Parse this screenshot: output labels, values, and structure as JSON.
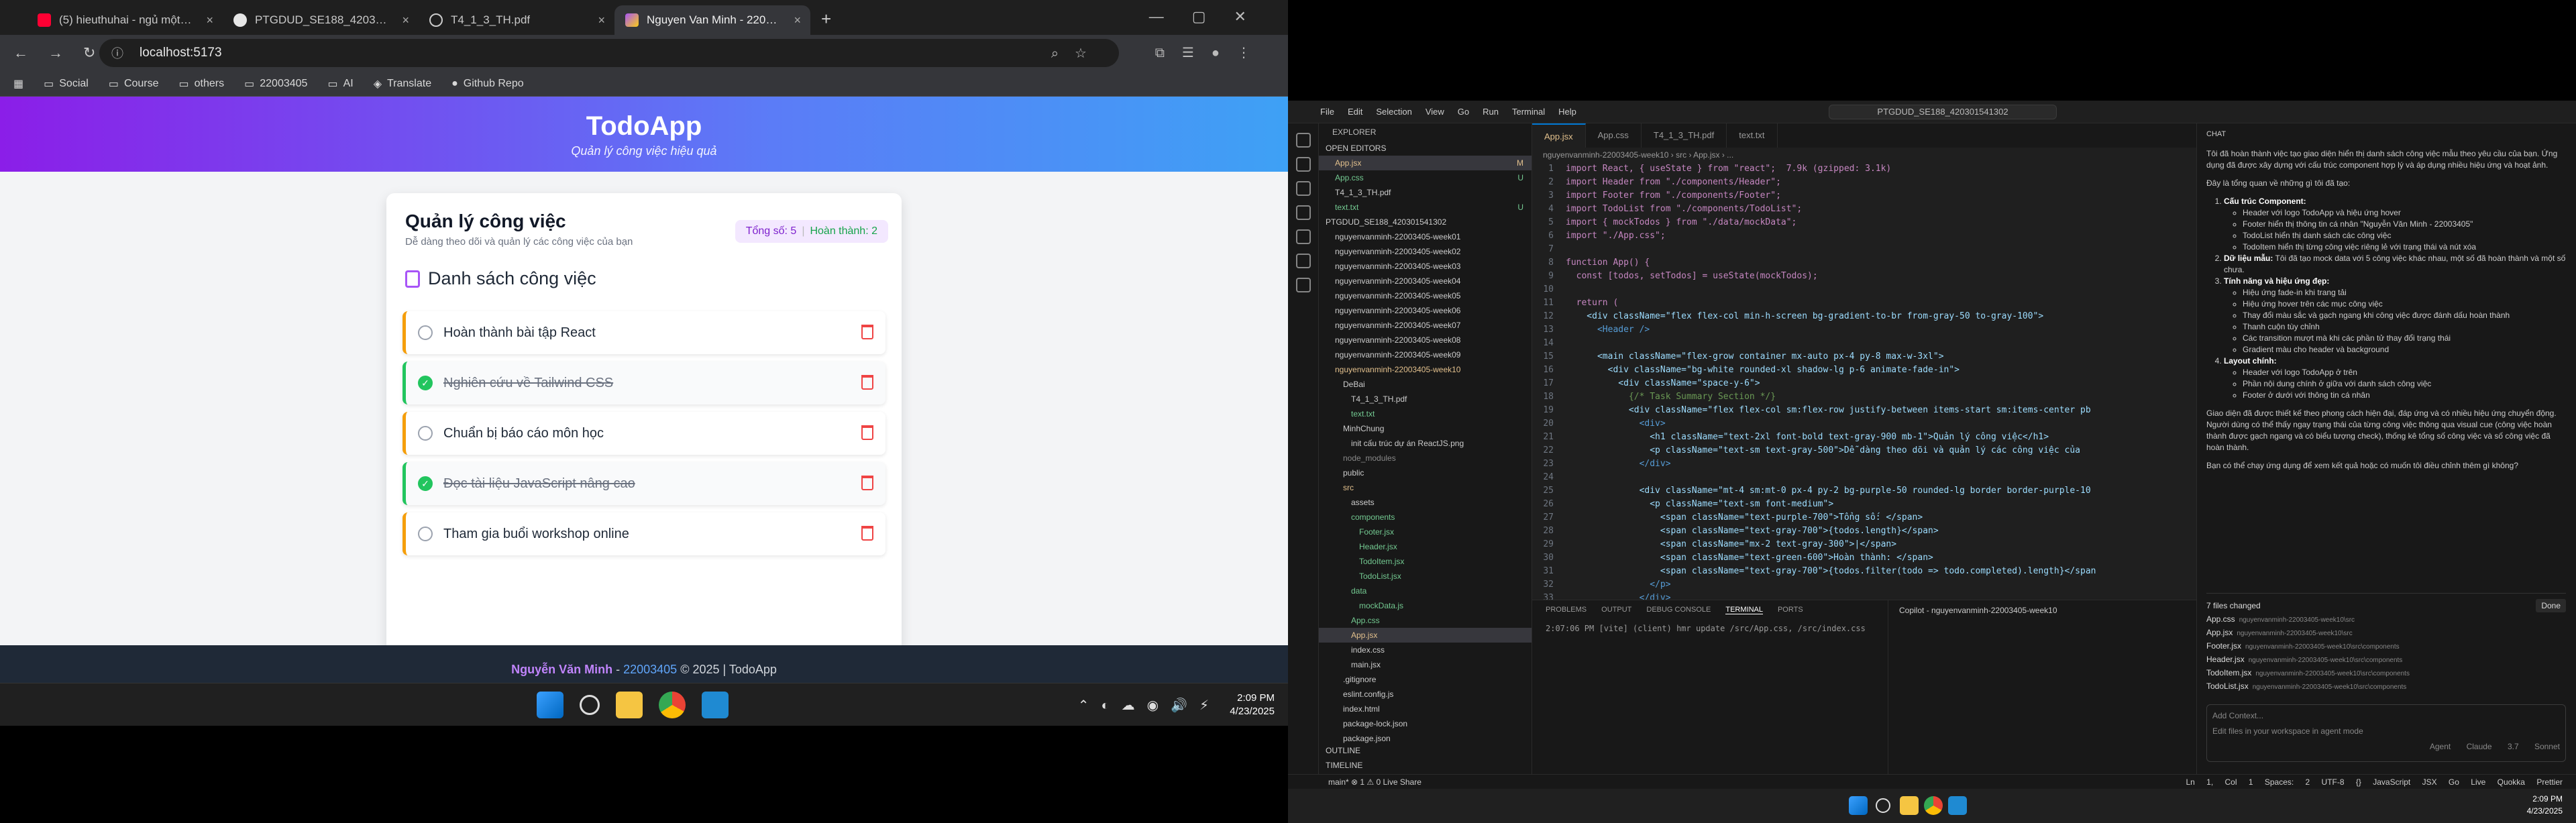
{
  "browser": {
    "tabs": [
      {
        "label": "(5) hieuthuhai - ngủ một mì",
        "color": "#ff0033"
      },
      {
        "label": "PTGDUD_SE188_42030154130",
        "color": "#e6e6e6"
      },
      {
        "label": "T4_1_3_TH.pdf",
        "color": "#e6e6e6"
      },
      {
        "label": "Nguyen Van Minh - 22003405",
        "color": "#facc15"
      }
    ],
    "url": "localhost:5173",
    "bookmarks": [
      "Social",
      "Course",
      "others",
      "22003405",
      "AI",
      "Translate",
      "Github Repo"
    ]
  },
  "app": {
    "title": "TodoApp",
    "subtitle": "Quản lý công việc hiệu quả",
    "heading": "Quản lý công việc",
    "description": "Dễ dàng theo dõi và quản lý các công việc của bạn",
    "total_label": "Tổng số: 5",
    "done_label": "Hoàn thành: 2",
    "list_title": "Danh sách công việc",
    "todos": [
      {
        "text": "Hoàn thành bài tập React",
        "done": false
      },
      {
        "text": "Nghiên cứu về Tailwind CSS",
        "done": true
      },
      {
        "text": "Chuẩn bị báo cáo môn học",
        "done": false
      },
      {
        "text": "Đọc tài liệu JavaScript nâng cao",
        "done": true
      },
      {
        "text": "Tham gia buổi workshop online",
        "done": false
      }
    ],
    "footer_name": "Nguyễn Văn Minh",
    "footer_id": "22003405",
    "footer_copy": "© 2025 | TodoApp"
  },
  "taskbar": {
    "time": "2:09 PM",
    "date": "4/23/2025"
  },
  "vscode": {
    "menu": [
      "File",
      "Edit",
      "Selection",
      "View",
      "Go",
      "Run",
      "Terminal",
      "Help"
    ],
    "search": "PTGDUD_SE188_420301541302",
    "tabs": [
      "App.jsx",
      "App.css",
      "T4_1_3_TH.pdf",
      "text.txt"
    ],
    "breadcrumb": "nguyenvanminh-22003405-week10 › src › App.jsx › ...",
    "explorer": {
      "title": "EXPLORER",
      "open_editors": "OPEN EDITORS",
      "open": [
        "App.jsx",
        "App.css",
        "T4_1_3_TH.pdf",
        "text.txt"
      ],
      "project": "PTGDUD_SE188_420301541302",
      "weeks": [
        "nguyenvanminh-22003405-week01",
        "nguyenvanminh-22003405-week02",
        "nguyenvanminh-22003405-week03",
        "nguyenvanminh-22003405-week04",
        "nguyenvanminh-22003405-week05",
        "nguyenvanminh-22003405-week06",
        "nguyenvanminh-22003405-week07",
        "nguyenvanminh-22003405-week08",
        "nguyenvanminh-22003405-week09",
        "nguyenvanminh-22003405-week10"
      ],
      "tree": [
        "DeBai",
        "T4_1_3_TH.pdf",
        "text.txt",
        "MinhChung",
        "init cấu trúc dự án ReactJS.png",
        "node_modules",
        "public",
        "src",
        "assets",
        "components",
        "Footer.jsx",
        "Header.jsx",
        "TodoItem.jsx",
        "TodoList.jsx",
        "data",
        "mockData.js",
        "App.css",
        "App.jsx",
        "index.css",
        "main.jsx",
        ".gitignore",
        "eslint.config.js",
        "index.html",
        "package-lock.json",
        "package.json"
      ],
      "outline": "OUTLINE",
      "timeline": "TIMELINE"
    },
    "code": [
      "import React, { useState } from \"react\";  7.9k (gzipped: 3.1k)",
      "import Header from \"./components/Header\";",
      "import Footer from \"./components/Footer\";",
      "import TodoList from \"./components/TodoList\";",
      "import { mockTodos } from \"./data/mockData\";",
      "import \"./App.css\";",
      "",
      "function App() {",
      "  const [todos, setTodos] = useState(mockTodos);",
      "",
      "  return (",
      "    <div className=\"flex flex-col min-h-screen bg-gradient-to-br from-gray-50 to-gray-100\">",
      "      <Header />",
      "",
      "      <main className=\"flex-grow container mx-auto px-4 py-8 max-w-3xl\">",
      "        <div className=\"bg-white rounded-xl shadow-lg p-6 animate-fade-in\">",
      "          <div className=\"space-y-6\">",
      "            {/* Task Summary Section */}",
      "            <div className=\"flex flex-col sm:flex-row justify-between items-start sm:items-center pb",
      "              <div>",
      "                <h1 className=\"text-2xl font-bold text-gray-900 mb-1\">Quản lý công việc</h1>",
      "                <p className=\"text-sm text-gray-500\">Dễ dàng theo dõi và quản lý các công việc của",
      "              </div>",
      "",
      "              <div className=\"mt-4 sm:mt-0 px-4 py-2 bg-purple-50 rounded-lg border border-purple-10",
      "                <p className=\"text-sm font-medium\">",
      "                  <span className=\"text-purple-700\">Tổng số: </span>",
      "                  <span className=\"text-gray-700\">{todos.length}</span>",
      "                  <span className=\"mx-2 text-gray-300\">|</span>",
      "                  <span className=\"text-green-600\">Hoàn thành: </span>",
      "                  <span className=\"text-gray-700\">{todos.filter(todo => todo.completed).length}</span",
      "                </p>",
      "              </div>",
      "            </div>"
    ],
    "terminal_tabs": [
      "PROBLEMS",
      "OUTPUT",
      "DEBUG CONSOLE",
      "TERMINAL",
      "PORTS"
    ],
    "terminal_line": "2:07:06 PM [vite] (client) hmr update /src/App.css, /src/index.css",
    "terminal2_title": "Copilot - nguyenvanminh-22003405-week10",
    "chat_title": "CHAT",
    "chat_intro": "Tôi đã hoàn thành việc tạo giao diện hiển thị danh sách công việc mẫu theo yêu cầu của bạn. Ứng dụng đã được xây dựng với cấu trúc component hợp lý và áp dụng nhiều hiệu ứng và hoạt ảnh.",
    "chat_summary": "Đây là tổng quan về những gì tôi đã tạo:",
    "chat_sections": [
      {
        "title": "Cấu trúc Component:",
        "items": [
          "Header với logo TodoApp và hiệu ứng hover",
          "Footer hiển thị thông tin cá nhân \"Nguyễn Văn Minh - 22003405\"",
          "TodoList hiển thị danh sách các công việc",
          "TodoItem hiển thị từng công việc riêng lẻ với trạng thái và nút xóa"
        ]
      },
      {
        "title": "Dữ liệu mẫu:",
        "items": [
          "Tôi đã tạo mock data với 5 công việc khác nhau, một số đã hoàn thành và một số chưa."
        ]
      },
      {
        "title": "Tính năng và hiệu ứng đẹp:",
        "items": [
          "Hiệu ứng fade-in khi trang tải",
          "Hiệu ứng hover trên các mục công việc",
          "Thay đổi màu sắc và gạch ngang khi công việc được đánh dấu hoàn thành",
          "Thanh cuộn tùy chỉnh",
          "Các transition mượt mà khi các phần tử thay đổi trạng thái",
          "Gradient màu cho header và background"
        ]
      },
      {
        "title": "Layout chính:",
        "items": [
          "Header với logo TodoApp ở trên",
          "Phần nội dung chính ở giữa với danh sách công việc",
          "Footer ở dưới với thông tin cá nhân"
        ]
      }
    ],
    "chat_outro": "Giao diện đã được thiết kế theo phong cách hiện đại, đáp ứng và có nhiều hiệu ứng chuyển động. Người dùng có thể thấy ngay trạng thái của từng công việc thông qua visual cue (công việc hoàn thành được gạch ngang và có biểu tượng check), thống kê tổng số công việc và số công việc đã hoàn thành.",
    "chat_question": "Bạn có thể chạy ứng dụng để xem kết quả hoặc có muốn tôi điều chỉnh thêm gì không?",
    "files_changed": "7 files changed",
    "done_btn": "Done",
    "changed": [
      {
        "f": "App.css",
        "p": "nguyenvanminh-22003405-week10\\src"
      },
      {
        "f": "App.jsx",
        "p": "nguyenvanminh-22003405-week10\\src"
      },
      {
        "f": "Footer.jsx",
        "p": "nguyenvanminh-22003405-week10\\src\\components"
      },
      {
        "f": "Header.jsx",
        "p": "nguyenvanminh-22003405-week10\\src\\components"
      },
      {
        "f": "TodoItem.jsx",
        "p": "nguyenvanminh-22003405-week10\\src\\components"
      },
      {
        "f": "TodoList.jsx",
        "p": "nguyenvanminh-22003405-week10\\src\\components"
      }
    ],
    "chat_placeholder": "Edit files in your workspace in agent mode",
    "add_context": "Add Context...",
    "agent": "Agent",
    "model": "Claude 3.7 Sonnet",
    "status_left": "main*   ⊗ 1 ⚠ 0    Live Share",
    "status_right": "Ln 1, Col 1  Spaces: 2  UTF-8  {} JavaScript JSX  Go Live  Quokka  Prettier"
  }
}
